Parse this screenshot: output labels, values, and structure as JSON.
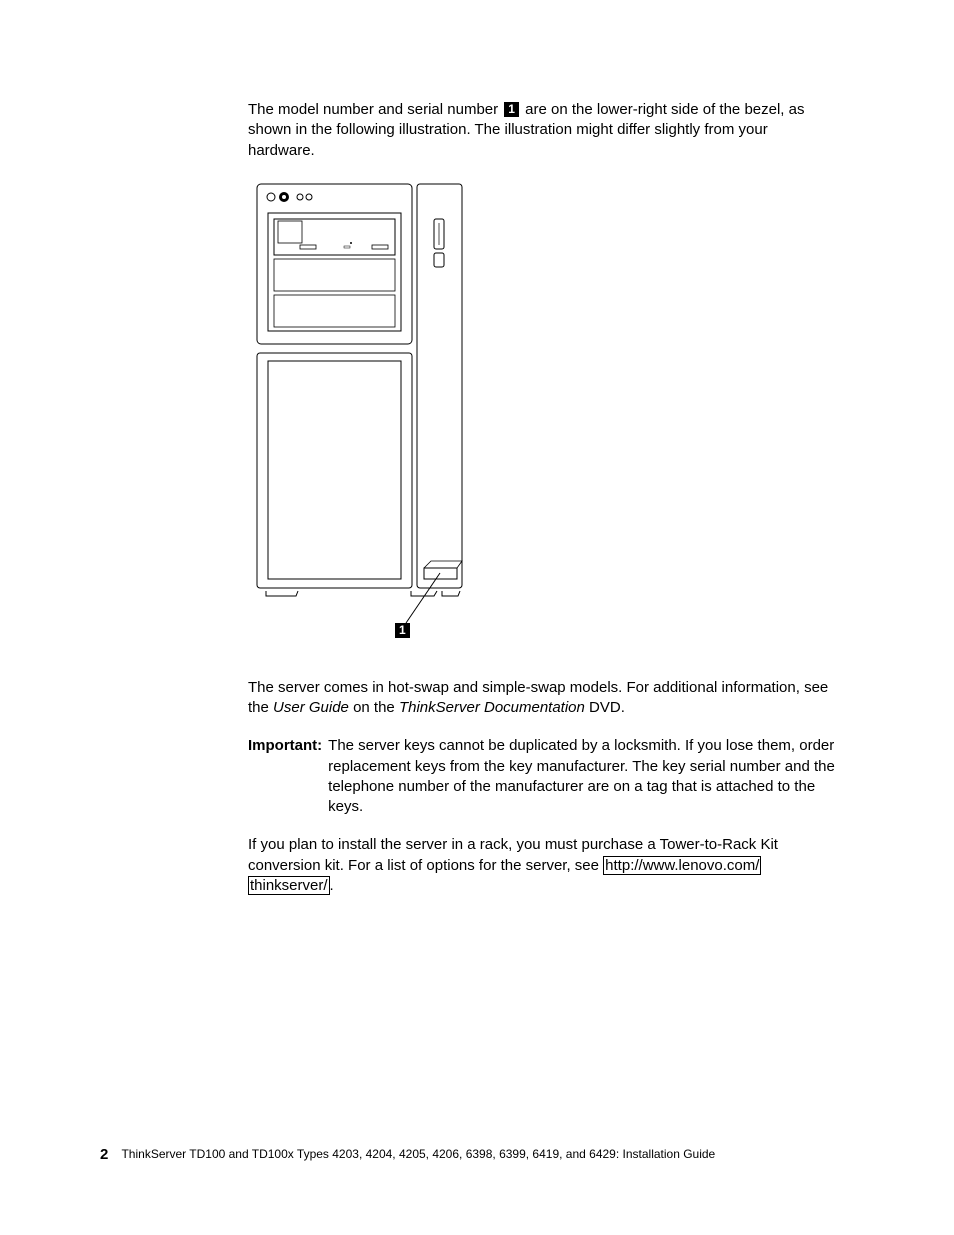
{
  "para1_a": "The model number and serial number ",
  "callout1": "1",
  "para1_b": " are on the lower-right side of the bezel, as shown in the following illustration. The illustration might differ slightly from your hardware.",
  "para2_a": "The server comes in hot-swap and simple-swap models. For additional information, see the ",
  "para2_i1": "User Guide",
  "para2_b": " on the ",
  "para2_i2": "ThinkServer Documentation",
  "para2_c": " DVD.",
  "important_label": "Important:",
  "important_text": "The server keys cannot be duplicated by a locksmith. If you lose them, order replacement keys from the key manufacturer. The key serial number and the telephone number of the manufacturer are on a tag that is attached to the keys.",
  "para3_a": "If you plan to install the server in a rack, you must purchase a Tower-to-Rack Kit conversion kit. For a list of options for the server, see ",
  "para3_link1": "http://www.lenovo.com/",
  "para3_link2": "thinkserver/",
  "para3_b": ".",
  "footer_page": "2",
  "footer_text": "ThinkServer TD100 and TD100x Types 4203, 4204, 4205, 4206, 6398, 6399, 6419, and 6429: Installation Guide",
  "callout_fig": "1"
}
